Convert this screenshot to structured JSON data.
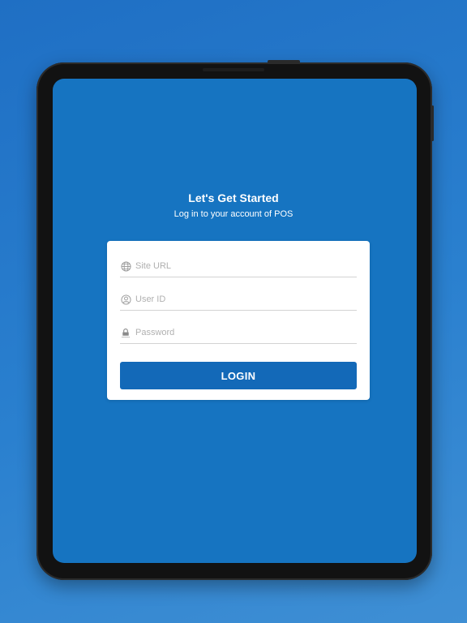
{
  "header": {
    "title": "Let's Get Started",
    "subtitle": "Log in to your account of POS"
  },
  "form": {
    "site_url": {
      "placeholder": "Site URL",
      "value": "",
      "icon": "globe-icon"
    },
    "user_id": {
      "placeholder": "User ID",
      "value": "",
      "icon": "user-icon"
    },
    "password": {
      "placeholder": "Password",
      "value": "",
      "icon": "lock-icon"
    },
    "login_label": "LOGIN"
  },
  "colors": {
    "background": "#2a7ccb",
    "screen": "#1674c1",
    "button": "#1369b8",
    "card": "#ffffff"
  }
}
